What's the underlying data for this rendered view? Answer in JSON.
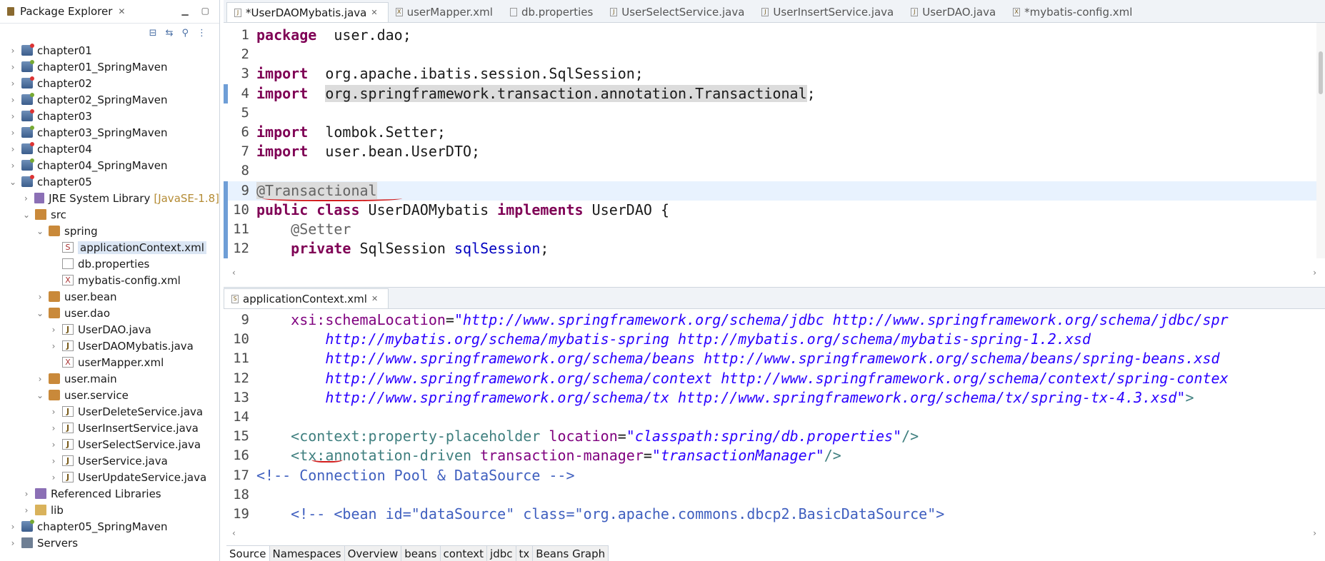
{
  "explorer": {
    "title": "Package Explorer",
    "tree": [
      {
        "label": "chapter01",
        "icon": "project-icon",
        "depth": 0,
        "arrow": "right"
      },
      {
        "label": "chapter01_SpringMaven",
        "icon": "maven-project-icon",
        "depth": 0,
        "arrow": "right"
      },
      {
        "label": "chapter02",
        "icon": "project-icon",
        "depth": 0,
        "arrow": "right"
      },
      {
        "label": "chapter02_SpringMaven",
        "icon": "maven-project-icon",
        "depth": 0,
        "arrow": "right"
      },
      {
        "label": "chapter03",
        "icon": "project-icon",
        "depth": 0,
        "arrow": "right"
      },
      {
        "label": "chapter03_SpringMaven",
        "icon": "maven-project-icon",
        "depth": 0,
        "arrow": "right"
      },
      {
        "label": "chapter04",
        "icon": "project-icon",
        "depth": 0,
        "arrow": "right"
      },
      {
        "label": "chapter04_SpringMaven",
        "icon": "maven-project-icon",
        "depth": 0,
        "arrow": "right"
      },
      {
        "label": "chapter05",
        "icon": "project-icon",
        "depth": 0,
        "arrow": "down"
      },
      {
        "label": "JRE System Library",
        "decoration": "[JavaSE-1.8]",
        "icon": "library-icon",
        "depth": 1,
        "arrow": "right"
      },
      {
        "label": "src",
        "icon": "source-folder-icon",
        "depth": 1,
        "arrow": "down"
      },
      {
        "label": "spring",
        "icon": "package-icon",
        "depth": 2,
        "arrow": "down"
      },
      {
        "label": "applicationContext.xml",
        "icon": "spring-xml-file-icon",
        "depth": 3,
        "arrow": "",
        "selected": true
      },
      {
        "label": "db.properties",
        "icon": "file-icon",
        "depth": 3,
        "arrow": ""
      },
      {
        "label": "mybatis-config.xml",
        "icon": "xml-file-icon",
        "depth": 3,
        "arrow": ""
      },
      {
        "label": "user.bean",
        "icon": "package-icon",
        "depth": 2,
        "arrow": "right"
      },
      {
        "label": "user.dao",
        "icon": "package-icon",
        "depth": 2,
        "arrow": "down"
      },
      {
        "label": "UserDAO.java",
        "icon": "java-file-icon",
        "depth": 3,
        "arrow": "right"
      },
      {
        "label": "UserDAOMybatis.java",
        "icon": "java-file-icon",
        "depth": 3,
        "arrow": "right"
      },
      {
        "label": "userMapper.xml",
        "icon": "xml-file-icon",
        "depth": 3,
        "arrow": ""
      },
      {
        "label": "user.main",
        "icon": "package-icon",
        "depth": 2,
        "arrow": "right"
      },
      {
        "label": "user.service",
        "icon": "package-icon",
        "depth": 2,
        "arrow": "down"
      },
      {
        "label": "UserDeleteService.java",
        "icon": "java-file-icon",
        "depth": 3,
        "arrow": "right"
      },
      {
        "label": "UserInsertService.java",
        "icon": "java-file-icon",
        "depth": 3,
        "arrow": "right"
      },
      {
        "label": "UserSelectService.java",
        "icon": "java-file-icon",
        "depth": 3,
        "arrow": "right"
      },
      {
        "label": "UserService.java",
        "icon": "java-file-icon",
        "depth": 3,
        "arrow": "right"
      },
      {
        "label": "UserUpdateService.java",
        "icon": "java-file-icon",
        "depth": 3,
        "arrow": "right"
      },
      {
        "label": "Referenced Libraries",
        "icon": "library-icon",
        "depth": 1,
        "arrow": "right"
      },
      {
        "label": "lib",
        "icon": "folder-icon",
        "depth": 1,
        "arrow": "right"
      },
      {
        "label": "chapter05_SpringMaven",
        "icon": "maven-project-icon",
        "depth": 0,
        "arrow": "right"
      },
      {
        "label": "Servers",
        "icon": "server-folder-icon",
        "depth": 0,
        "arrow": "right"
      }
    ]
  },
  "editor": {
    "tabs": [
      {
        "label": "*UserDAOMybatis.java",
        "active": true,
        "closable": true
      },
      {
        "label": "userMapper.xml"
      },
      {
        "label": "db.properties"
      },
      {
        "label": "UserSelectService.java"
      },
      {
        "label": "UserInsertService.java"
      },
      {
        "label": "UserDAO.java"
      },
      {
        "label": "*mybatis-config.xml"
      }
    ],
    "lines": [
      {
        "n": "1",
        "parts": [
          [
            "kw",
            "package"
          ],
          [
            "",
            "  user.dao;"
          ]
        ]
      },
      {
        "n": "2",
        "parts": []
      },
      {
        "n": "3",
        "fold": true,
        "parts": [
          [
            "kw",
            "import"
          ],
          [
            "",
            "  org.apache.ibatis.session.SqlSession;"
          ]
        ]
      },
      {
        "n": "4",
        "parts": [
          [
            "kw",
            "import"
          ],
          [
            "",
            "  "
          ],
          [
            "hl",
            "org.springframework.transaction.annotation.Transactional"
          ],
          [
            "",
            ";"
          ]
        ]
      },
      {
        "n": "5",
        "parts": []
      },
      {
        "n": "6",
        "parts": [
          [
            "kw",
            "import"
          ],
          [
            "",
            "  lombok.Setter;"
          ]
        ]
      },
      {
        "n": "7",
        "parts": [
          [
            "kw",
            "import"
          ],
          [
            "",
            "  user.bean.UserDTO;"
          ]
        ]
      },
      {
        "n": "8",
        "parts": []
      },
      {
        "n": "9",
        "current": true,
        "parts": [
          [
            "ann hl",
            "@Transactional"
          ]
        ]
      },
      {
        "n": "10",
        "parts": [
          [
            "kw",
            "public"
          ],
          [
            "",
            " "
          ],
          [
            "kw",
            "class"
          ],
          [
            "",
            " UserDAOMybatis "
          ],
          [
            "kw",
            "implements"
          ],
          [
            "",
            " UserDAO {"
          ]
        ]
      },
      {
        "n": "11",
        "fold": true,
        "parts": [
          [
            "",
            "    "
          ],
          [
            "ann",
            "@Setter"
          ]
        ]
      },
      {
        "n": "12",
        "parts": [
          [
            "",
            "    "
          ],
          [
            "kw",
            "private"
          ],
          [
            "",
            " SqlSession "
          ],
          [
            "fld",
            "sqlSession"
          ],
          [
            "",
            ";"
          ]
        ]
      }
    ]
  },
  "xml_editor": {
    "tab": "applicationContext.xml",
    "lines": [
      {
        "n": "9",
        "parts": [
          [
            "",
            "    "
          ],
          [
            "xattr",
            "xsi:schemaLocation"
          ],
          [
            "",
            "="
          ],
          [
            "xval",
            "\"http://www.springframework.org/schema/jdbc http://www.springframework.org/schema/jdbc/spr"
          ]
        ]
      },
      {
        "n": "10",
        "parts": [
          [
            "",
            "        "
          ],
          [
            "xval",
            "http://mybatis.org/schema/mybatis-spring http://mybatis.org/schema/mybatis-spring-1.2.xsd"
          ]
        ]
      },
      {
        "n": "11",
        "parts": [
          [
            "",
            "        "
          ],
          [
            "xval",
            "http://www.springframework.org/schema/beans http://www.springframework.org/schema/beans/spring-beans.xsd"
          ]
        ]
      },
      {
        "n": "12",
        "parts": [
          [
            "",
            "        "
          ],
          [
            "xval",
            "http://www.springframework.org/schema/context http://www.springframework.org/schema/context/spring-contex"
          ]
        ]
      },
      {
        "n": "13",
        "parts": [
          [
            "",
            "        "
          ],
          [
            "xval",
            "http://www.springframework.org/schema/tx http://www.springframework.org/schema/tx/spring-tx-4.3.xsd\""
          ],
          [
            "xtag",
            ">"
          ]
        ]
      },
      {
        "n": "14",
        "parts": []
      },
      {
        "n": "15",
        "parts": [
          [
            "",
            "    "
          ],
          [
            "xtag",
            "<context:property-placeholder"
          ],
          [
            "",
            " "
          ],
          [
            "xattr",
            "location"
          ],
          [
            "",
            "="
          ],
          [
            "xval",
            "\"classpath:spring/db.properties\""
          ],
          [
            "xtag",
            "/>"
          ]
        ]
      },
      {
        "n": "16",
        "parts": [
          [
            "",
            "    "
          ],
          [
            "xtag",
            "<tx:annotation-driven"
          ],
          [
            "",
            " "
          ],
          [
            "xattr",
            "transaction-manager"
          ],
          [
            "",
            "="
          ],
          [
            "xval",
            "\"transactionManager\""
          ],
          [
            "xtag",
            "/>"
          ]
        ]
      },
      {
        "n": "17",
        "parts": [
          [
            "xcom",
            "<!-- Connection Pool & DataSource -->"
          ]
        ]
      },
      {
        "n": "18",
        "parts": []
      },
      {
        "n": "19",
        "fold": true,
        "parts": [
          [
            "",
            "    "
          ],
          [
            "xcom",
            "<!-- <bean id=\"dataSource\" class=\"org.apache.commons.dbcp2.BasicDataSource\">"
          ]
        ]
      }
    ],
    "bottom_tabs": [
      "Source",
      "Namespaces",
      "Overview",
      "beans",
      "context",
      "jdbc",
      "tx",
      "Beans Graph"
    ]
  }
}
